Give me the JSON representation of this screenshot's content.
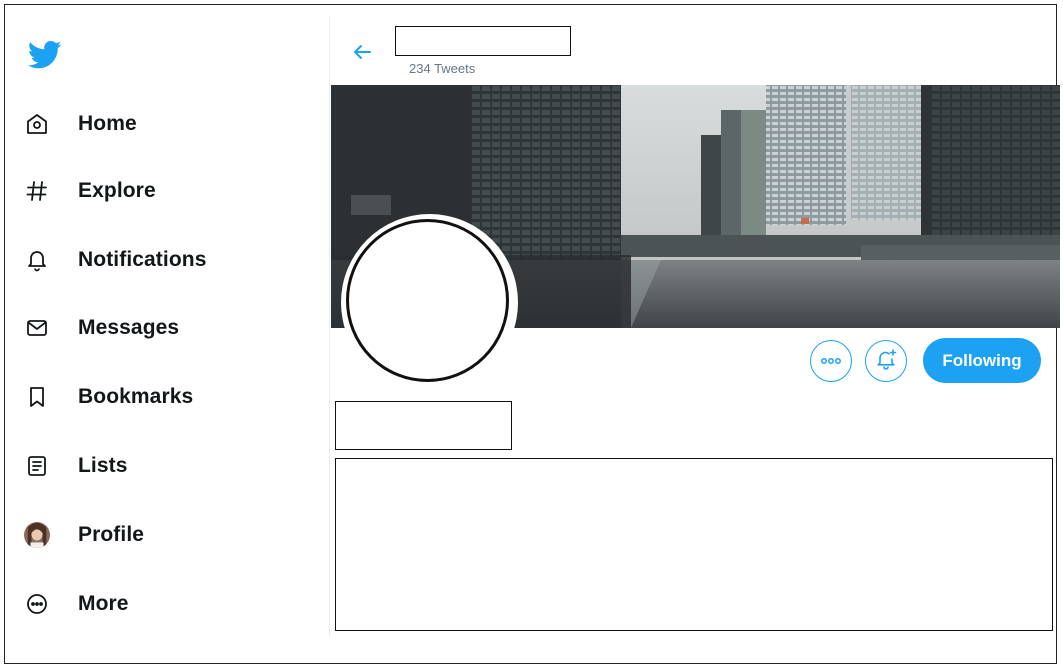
{
  "app": {
    "brand_color": "#1da1f2"
  },
  "sidebar": {
    "logo_icon": "twitter-bird-icon",
    "items": [
      {
        "label": "Home",
        "icon": "home-icon"
      },
      {
        "label": "Explore",
        "icon": "hashtag-icon"
      },
      {
        "label": "Notifications",
        "icon": "bell-icon"
      },
      {
        "label": "Messages",
        "icon": "envelope-icon"
      },
      {
        "label": "Bookmarks",
        "icon": "bookmark-icon"
      },
      {
        "label": "Lists",
        "icon": "list-icon"
      },
      {
        "label": "Profile",
        "icon": "avatar-icon"
      },
      {
        "label": "More",
        "icon": "more-icon"
      }
    ]
  },
  "profile_header": {
    "back_icon": "arrow-left-icon",
    "tweet_count": "234 Tweets"
  },
  "profile": {
    "actions": {
      "more_icon": "more-dots-icon",
      "notify_icon": "bell-plus-icon",
      "follow_label": "Following"
    }
  }
}
